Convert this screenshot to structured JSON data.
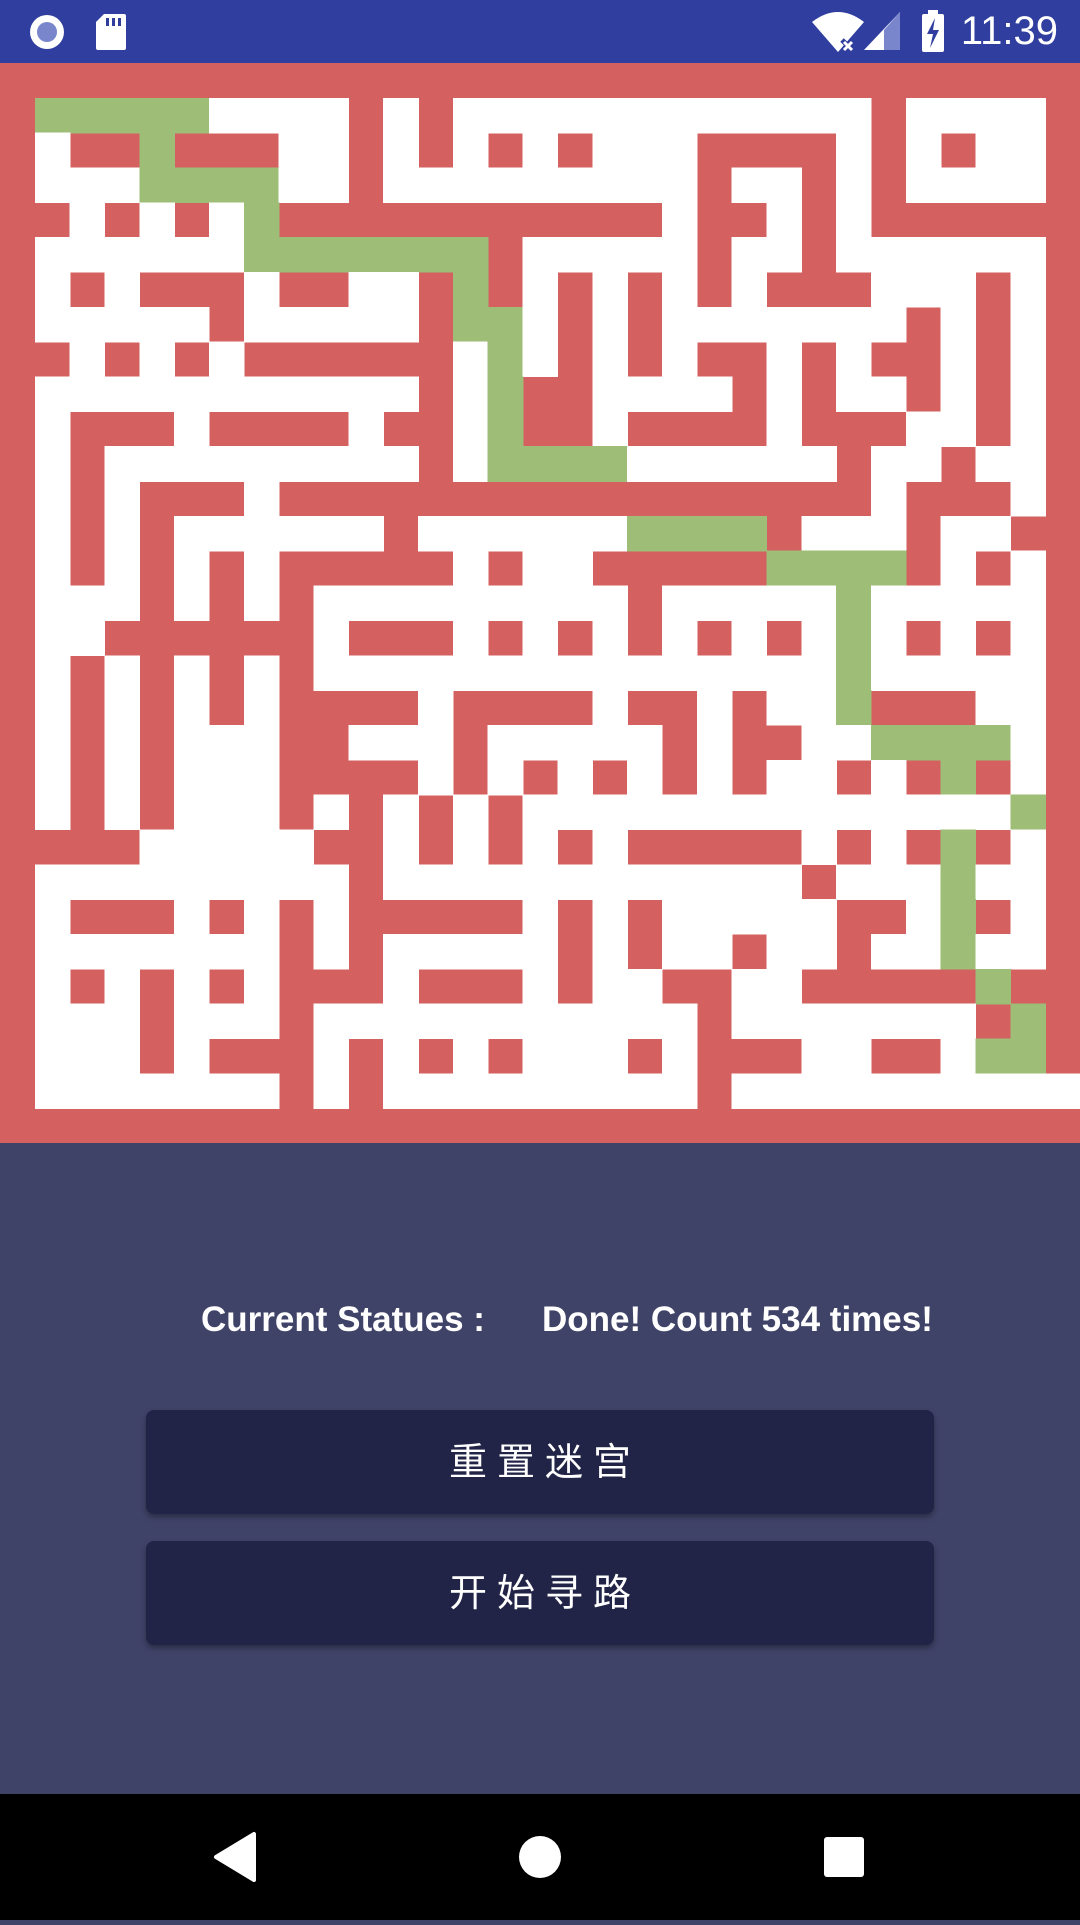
{
  "status_bar": {
    "time": "11:39",
    "icons": [
      "record-icon",
      "sd-card-icon",
      "wifi-icon",
      "signal-icon",
      "battery-charging-icon"
    ]
  },
  "maze": {
    "rows": 31,
    "cols": 31,
    "colors": {
      "wall": "#D46060",
      "floor": "#FFFFFF",
      "path": "#9EBD77"
    }
  },
  "status": {
    "label": "Current Statues :",
    "value": "Done! Count 534 times!"
  },
  "buttons": {
    "reset_maze": "重置迷宫",
    "start_pathfinding": "开始寻路"
  },
  "nav_bar": {
    "icons": [
      "back-icon",
      "home-icon",
      "recents-icon"
    ]
  }
}
